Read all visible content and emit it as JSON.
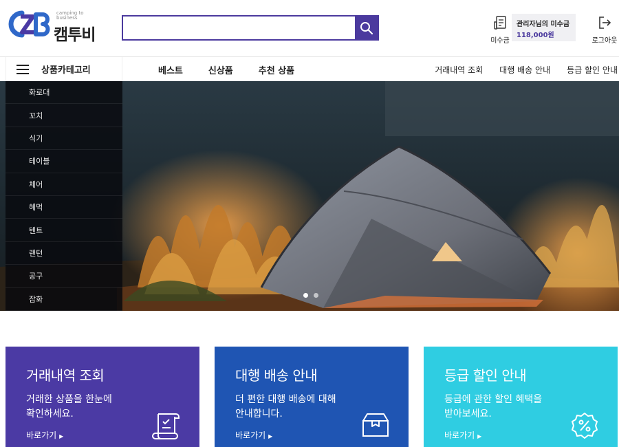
{
  "logo": {
    "brand": "캠투비",
    "tagline_line1": "camping to",
    "tagline_line2": "business"
  },
  "search": {
    "value": "",
    "placeholder": ""
  },
  "header": {
    "unpaid_label": "미수금",
    "debt_title": "관리자님의 미수금",
    "debt_amount": "118,000원",
    "logout_label": "로그아웃"
  },
  "nav": {
    "category_label": "상품카테고리",
    "main": [
      "베스트",
      "신상품",
      "추천 상품"
    ],
    "sub": [
      "거래내역 조회",
      "대행 배송 안내",
      "등급 할인 안내"
    ]
  },
  "categories": [
    "화로대",
    "꼬치",
    "식기",
    "테이블",
    "체어",
    "혜먹",
    "텐트",
    "랜턴",
    "공구",
    "잡화"
  ],
  "hero": {
    "slide_count": 2,
    "active_slide": 1
  },
  "cards": [
    {
      "title": "거래내역 조회",
      "desc_line1": "거래한 상품을 한눈에",
      "desc_line2": "확인하세요.",
      "link": "바로가기",
      "icon": "document-check-icon",
      "color": "#4b3aa4"
    },
    {
      "title": "대행 배송 안내",
      "desc_line1": "더 편한 대행 배송에 대해",
      "desc_line2": "안내합니다.",
      "link": "바로가기",
      "icon": "box-icon",
      "color": "#1f55b3"
    },
    {
      "title": "등급 할인 안내",
      "desc_line1": "등급에 관한 할인 혜택을",
      "desc_line2": "받아보세요.",
      "link": "바로가기",
      "icon": "percent-badge-icon",
      "color": "#2fcde2"
    }
  ],
  "colors": {
    "accent": "#4b3a9e",
    "logo_blue": "#2f68c9"
  }
}
